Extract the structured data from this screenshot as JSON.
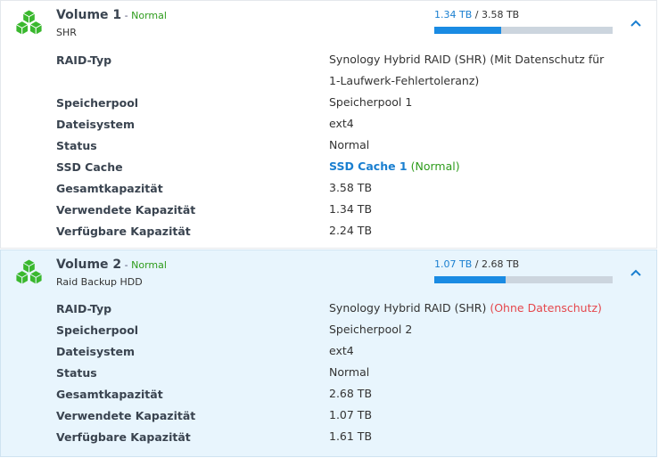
{
  "volumes": [
    {
      "name": "Volume 1",
      "separator": " - ",
      "status": "Normal",
      "subtitle": "SHR",
      "used": "1.34 TB",
      "slash": " / ",
      "total": "3.58 TB",
      "usage_fraction": 0.374,
      "details": {
        "raid_label": "RAID-Typ",
        "raid_line1": "Synology Hybrid RAID (SHR) (Mit Datenschutz für",
        "raid_line2": "1-Laufwerk-Fehlertoleranz)",
        "pool_label": "Speicherpool",
        "pool_value": "Speicherpool 1",
        "fs_label": "Dateisystem",
        "fs_value": "ext4",
        "status_label": "Status",
        "status_value": "Normal",
        "cache_label": "SSD Cache",
        "cache_link": "SSD Cache 1",
        "cache_status": " (Normal)",
        "total_label": "Gesamtkapazität",
        "total_value": "3.58 TB",
        "used_label": "Verwendete Kapazität",
        "used_value": "1.34 TB",
        "free_label": "Verfügbare Kapazität",
        "free_value": "2.24 TB"
      }
    },
    {
      "name": "Volume 2",
      "separator": " - ",
      "status": "Normal",
      "subtitle": "Raid Backup HDD",
      "used": "1.07 TB",
      "slash": " / ",
      "total": "2.68 TB",
      "usage_fraction": 0.399,
      "details": {
        "raid_label": "RAID-Typ",
        "raid_value": "Synology Hybrid RAID (SHR) ",
        "raid_warning": "(Ohne Datenschutz)",
        "pool_label": "Speicherpool",
        "pool_value": "Speicherpool 2",
        "fs_label": "Dateisystem",
        "fs_value": "ext4",
        "status_label": "Status",
        "status_value": "Normal",
        "total_label": "Gesamtkapazität",
        "total_value": "2.68 TB",
        "used_label": "Verwendete Kapazität",
        "used_value": "1.07 TB",
        "free_label": "Verfügbare Kapazität",
        "free_value": "1.61 TB"
      }
    }
  ],
  "icons": {
    "volume": "green-cubes-icon",
    "collapse": "chevron-up-icon"
  },
  "colors": {
    "accent": "#1a8be3",
    "status_ok": "#2e9c1c",
    "warning": "#e5474c",
    "cube": "#3ab82e"
  }
}
